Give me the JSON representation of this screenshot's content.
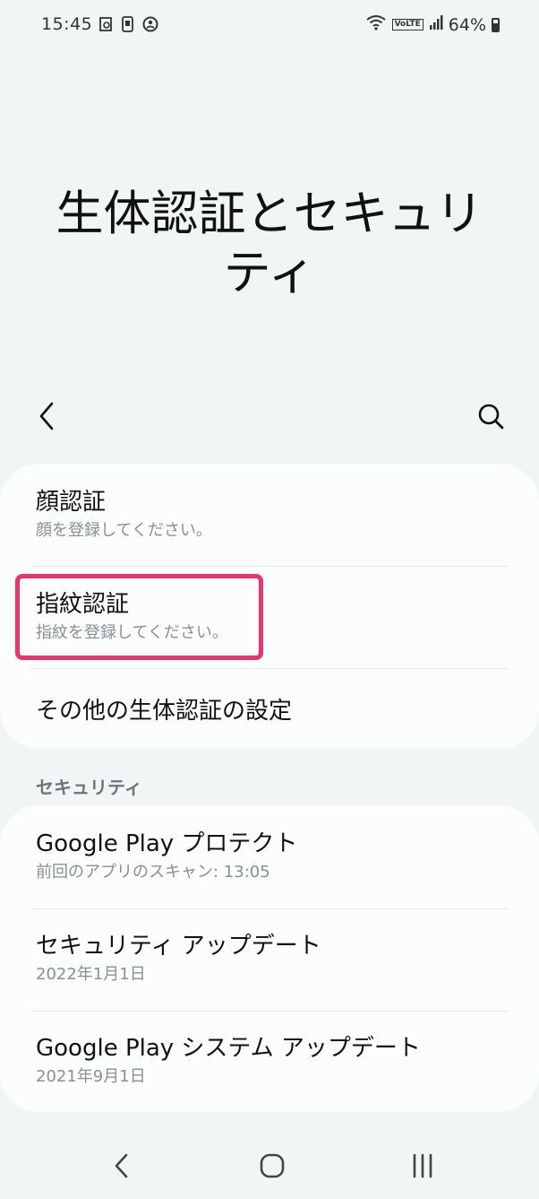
{
  "status_bar": {
    "time": "15:45",
    "battery": "64%",
    "network_badge": "VoLTE",
    "icons": [
      "gallery-notification-icon",
      "screen-record-icon",
      "game-launcher-icon",
      "wifi-icon",
      "signal-icon",
      "battery-icon"
    ]
  },
  "page": {
    "title": "生体認証とセキュリティ"
  },
  "toolbar": {
    "back_icon": "chevron-left-icon",
    "search_icon": "search-icon"
  },
  "biometrics": {
    "items": [
      {
        "title": "顔認証",
        "subtitle": "顔を登録してください。"
      },
      {
        "title": "指紋認証",
        "subtitle": "指紋を登録してください。"
      },
      {
        "title": "その他の生体認証の設定"
      }
    ],
    "highlight_color": "#f0326c"
  },
  "security": {
    "header": "セキュリティ",
    "items": [
      {
        "title": "Google Play プロテクト",
        "subtitle": "前回のアプリのスキャン: 13:05"
      },
      {
        "title": "セキュリティ アップデート",
        "subtitle": "2022年1月1日"
      },
      {
        "title": "Google Play システム アップデート",
        "subtitle": "2021年9月1日"
      }
    ]
  },
  "nav_bar": {
    "buttons": [
      "back-nav-icon",
      "home-nav-icon",
      "recents-nav-icon"
    ]
  }
}
